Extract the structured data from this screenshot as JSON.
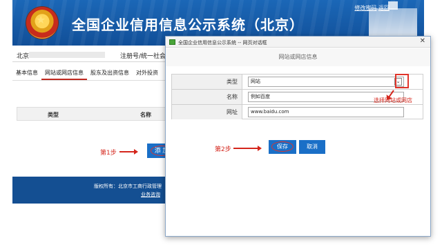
{
  "site": {
    "title": "全国企业信用信息公示系统（北京）",
    "top_links": {
      "change_password": "修改密码",
      "back": "返回"
    },
    "info": {
      "city": "北京",
      "reg_label": "注册号/统一社会"
    },
    "tabs": [
      "基本信息",
      "网站或网店信息",
      "股东及出资信息",
      "对外投资"
    ],
    "active_tab": 1,
    "table_headers": {
      "type": "类型",
      "name": "名称"
    },
    "step1_label": "第1步",
    "add_button": "添 加",
    "footer": {
      "copyright": "版权所有：北京市工商行政管理",
      "business": "业务咨询"
    }
  },
  "dialog": {
    "title": "全国企业信用信息公示系统 -- 网页对话框",
    "header": "网站或网店信息",
    "fields": {
      "type": {
        "label": "类型",
        "value": "网站"
      },
      "name": {
        "label": "名称",
        "value": "例如百度"
      },
      "url": {
        "label": "网址",
        "value": "www.baidu.com"
      }
    },
    "select_note": "选择网站或网店",
    "step2_label": "第2步",
    "save_button": "保存",
    "cancel_button": "取消"
  },
  "colors": {
    "accent_blue": "#1a6fc7",
    "banner_blue": "#114f98",
    "annotation_red": "#d4251b"
  }
}
